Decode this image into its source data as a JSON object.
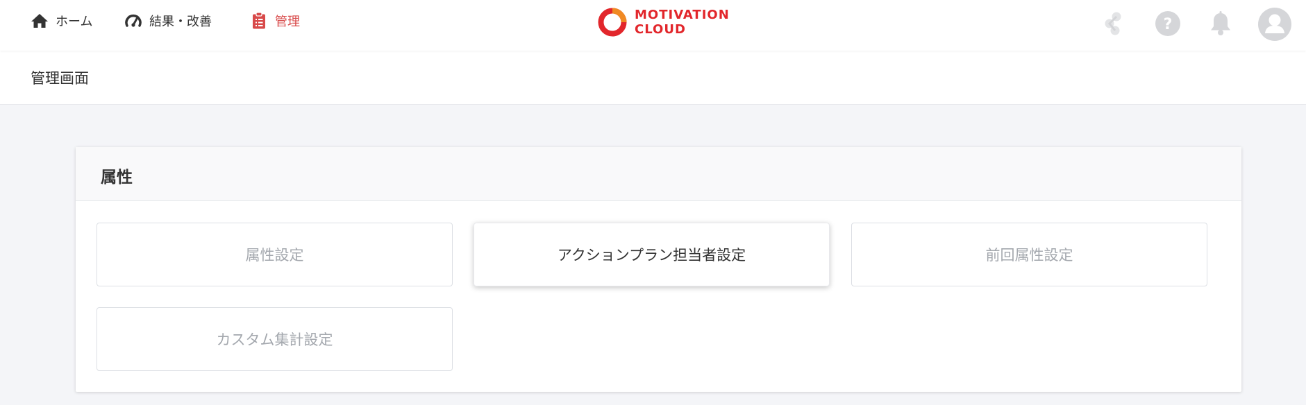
{
  "nav": {
    "home_label": "ホーム",
    "results_label": "結果・改善",
    "admin_label": "管理",
    "active_color": "#d84a4a"
  },
  "logo": {
    "line1": "MOTIVATION",
    "line2": "CLOUD",
    "color": "#e2262b"
  },
  "header_icons": [
    "link-icon",
    "help-icon",
    "bell-icon",
    "avatar-icon"
  ],
  "page": {
    "title": "管理画面"
  },
  "section": {
    "title": "属性",
    "tiles": [
      {
        "label": "属性設定",
        "active": false
      },
      {
        "label": "アクションプラン担当者設定",
        "active": true
      },
      {
        "label": "前回属性設定",
        "active": false
      },
      {
        "label": "カスタム集計設定",
        "active": false
      }
    ]
  }
}
